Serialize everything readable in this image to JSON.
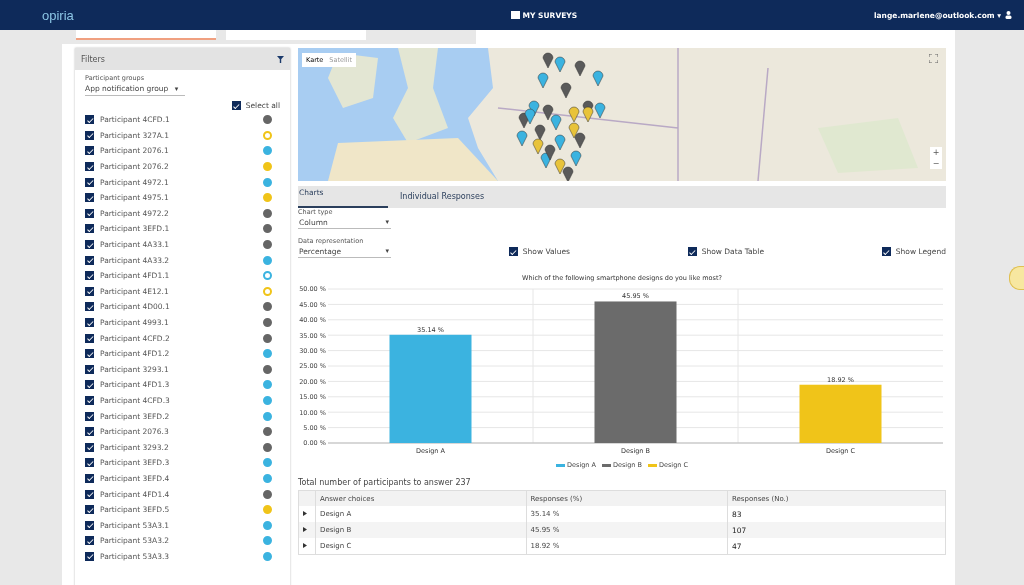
{
  "top_bar": {
    "logo": "opiria",
    "nav_label": "MY SURVEYS",
    "user": "lange.marlene@outlook.com",
    "menu_caret": "▾"
  },
  "filters": {
    "title": "Filters",
    "group_label": "Participant groups",
    "group_value": "App notification group",
    "group_caret": "▾",
    "select_all": {
      "label": "Select all",
      "checked": true
    },
    "participants": [
      {
        "name": "Participant 4CFD.1",
        "checked": true,
        "color": "#666666",
        "hollow": false
      },
      {
        "name": "Participant 327A.1",
        "checked": true,
        "color": "#f0c419",
        "hollow": true
      },
      {
        "name": "Participant 2076.1",
        "checked": true,
        "color": "#3bb3e0",
        "hollow": false
      },
      {
        "name": "Participant 2076.2",
        "checked": true,
        "color": "#f0c419",
        "hollow": false
      },
      {
        "name": "Participant 4972.1",
        "checked": true,
        "color": "#3bb3e0",
        "hollow": false
      },
      {
        "name": "Participant 4975.1",
        "checked": true,
        "color": "#f0c419",
        "hollow": false
      },
      {
        "name": "Participant 4972.2",
        "checked": true,
        "color": "#666666",
        "hollow": false
      },
      {
        "name": "Participant 3EFD.1",
        "checked": true,
        "color": "#666666",
        "hollow": false
      },
      {
        "name": "Participant 4A33.1",
        "checked": true,
        "color": "#666666",
        "hollow": false
      },
      {
        "name": "Participant 4A33.2",
        "checked": true,
        "color": "#3bb3e0",
        "hollow": false
      },
      {
        "name": "Participant 4FD1.1",
        "checked": true,
        "color": "#3bb3e0",
        "hollow": true
      },
      {
        "name": "Participant 4E12.1",
        "checked": true,
        "color": "#f0c419",
        "hollow": true
      },
      {
        "name": "Participant 4D00.1",
        "checked": true,
        "color": "#666666",
        "hollow": false
      },
      {
        "name": "Participant 4993.1",
        "checked": true,
        "color": "#666666",
        "hollow": false
      },
      {
        "name": "Participant 4CFD.2",
        "checked": true,
        "color": "#666666",
        "hollow": false
      },
      {
        "name": "Participant 4FD1.2",
        "checked": true,
        "color": "#3bb3e0",
        "hollow": false
      },
      {
        "name": "Participant 3293.1",
        "checked": true,
        "color": "#666666",
        "hollow": false
      },
      {
        "name": "Participant 4FD1.3",
        "checked": true,
        "color": "#3bb3e0",
        "hollow": false
      },
      {
        "name": "Participant 4CFD.3",
        "checked": true,
        "color": "#3bb3e0",
        "hollow": false
      },
      {
        "name": "Participant 3EFD.2",
        "checked": true,
        "color": "#3bb3e0",
        "hollow": false
      },
      {
        "name": "Participant 2076.3",
        "checked": true,
        "color": "#666666",
        "hollow": false
      },
      {
        "name": "Participant 3293.2",
        "checked": true,
        "color": "#666666",
        "hollow": false
      },
      {
        "name": "Participant 3EFD.3",
        "checked": true,
        "color": "#3bb3e0",
        "hollow": false
      },
      {
        "name": "Participant 3EFD.4",
        "checked": true,
        "color": "#3bb3e0",
        "hollow": false
      },
      {
        "name": "Participant 4FD1.4",
        "checked": true,
        "color": "#666666",
        "hollow": false
      },
      {
        "name": "Participant 3EFD.5",
        "checked": true,
        "color": "#f0c419",
        "hollow": false
      },
      {
        "name": "Participant 53A3.1",
        "checked": true,
        "color": "#3bb3e0",
        "hollow": false
      },
      {
        "name": "Participant 53A3.2",
        "checked": true,
        "color": "#3bb3e0",
        "hollow": false
      },
      {
        "name": "Participant 53A3.3",
        "checked": true,
        "color": "#3bb3e0",
        "hollow": false
      }
    ]
  },
  "map": {
    "type_buttons": [
      {
        "label": "Karte",
        "selected": true
      },
      {
        "label": "Satellit",
        "selected": false
      }
    ],
    "zoom_in": "+",
    "zoom_out": "−"
  },
  "tabs": [
    {
      "label": "Charts",
      "selected": true
    },
    {
      "label": "Individual Responses",
      "selected": false
    }
  ],
  "chart_type": {
    "label": "Chart type",
    "value": "Column",
    "caret": "▾"
  },
  "data_representation": {
    "label": "Data representation",
    "value": "Percentage",
    "caret": "▾"
  },
  "options": [
    {
      "label": "Show Values",
      "checked": true
    },
    {
      "label": "Show Data Table",
      "checked": true
    },
    {
      "label": "Show Legend",
      "checked": true
    }
  ],
  "chart_data": {
    "type": "bar",
    "title": "Which of the following smartphone designs do you like most?",
    "categories": [
      "Design A",
      "Design B",
      "Design C"
    ],
    "series": [
      {
        "name": "Design A",
        "color": "#3bb3e0",
        "values": [
          35.14,
          null,
          null
        ]
      },
      {
        "name": "Design B",
        "color": "#6b6b6b",
        "values": [
          null,
          45.95,
          null
        ]
      },
      {
        "name": "Design C",
        "color": "#f0c419",
        "values": [
          null,
          null,
          18.92
        ]
      }
    ],
    "stacked": true,
    "grid": true,
    "ylim": [
      0,
      50
    ],
    "yticks": [
      {
        "value": 0,
        "label": "0.00 %"
      },
      {
        "value": 5,
        "label": "5.00 %"
      },
      {
        "value": 10,
        "label": "10.00 %"
      },
      {
        "value": 15,
        "label": "15.00 %"
      },
      {
        "value": 20,
        "label": "20.00 %"
      },
      {
        "value": 25,
        "label": "25.00 %"
      },
      {
        "value": 30,
        "label": "30.00 %"
      },
      {
        "value": 35,
        "label": "35.00 %"
      },
      {
        "value": 40,
        "label": "40.00 %"
      },
      {
        "value": 45,
        "label": "45.00 %"
      },
      {
        "value": 50,
        "label": "50.00 %"
      }
    ],
    "value_labels": [
      "35.14 %",
      "45.95 %",
      "18.92 %"
    ]
  },
  "total": "Total number of participants to answer 237",
  "table": {
    "columns": [
      "Answer choices",
      "Responses (%)",
      "Responses (No.)"
    ],
    "rows": [
      {
        "cells": [
          "Design A",
          "35.14 %",
          "83"
        ]
      },
      {
        "cells": [
          "Design B",
          "45.95 %",
          "107"
        ]
      },
      {
        "cells": [
          "Design C",
          "18.92 %",
          "47"
        ]
      }
    ]
  }
}
